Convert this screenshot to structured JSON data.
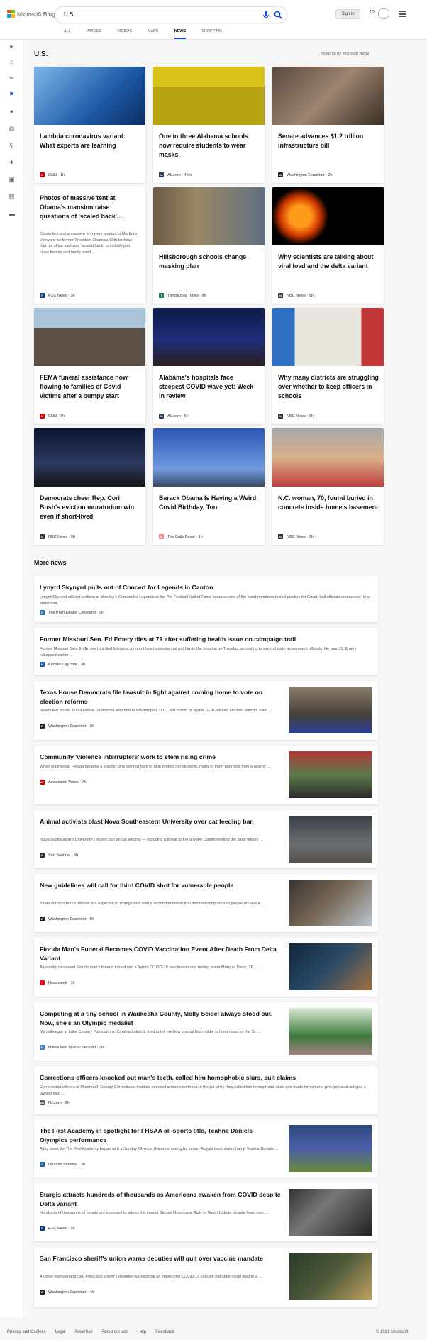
{
  "header": {
    "logo_text": "Microsoft Bing",
    "search_value": "U.S.",
    "signin": "Sign in",
    "rewards_count": "10",
    "tabs": [
      "ALL",
      "IMAGES",
      "VIDEOS",
      "MAPS",
      "NEWS",
      "SHOPPING"
    ],
    "active_tab": "NEWS",
    "logo_colors": [
      "#f25022",
      "#7fba00",
      "#00a4ef",
      "#ffb900"
    ],
    "accent": "#174ae4"
  },
  "rail": {
    "icons": [
      "expand-icon",
      "home-icon",
      "sparkle-icon",
      "flag-icon",
      "pin-icon",
      "globe-icon",
      "microscope-icon",
      "rocket-icon",
      "film-icon",
      "bank-icon",
      "card-icon"
    ]
  },
  "page": {
    "title": "U.S.",
    "powered_by": "Powered by Microsoft News"
  },
  "cards": [
    {
      "title": "Lambda coronavirus variant: What experts are learning",
      "source": "CNN",
      "time": "1h"
    },
    {
      "title": "One in three Alabama schools now require students to wear masks",
      "source": "AL.com",
      "time": "45m"
    },
    {
      "title": "Senate advances $1.2 trillion infrastructure bill",
      "source": "Washington Examiner",
      "time": "2h"
    },
    {
      "title": "Photos of massive tent at Obama's mansion raise questions of 'scaled back'...",
      "snippet": "Celebrities and a massive tent were spotted in Martha's Vineyard for former President Obama's 60th birthday that his office said was \"scaled back\" to include just close friends and family amid ...",
      "source": "FOX News",
      "time": "3h"
    },
    {
      "title": "Hillsborough schools change masking plan",
      "source": "Tampa Bay Times",
      "time": "9h"
    },
    {
      "title": "Why scientists are talking about viral load and the delta variant",
      "source": "NBC News",
      "time": "5h"
    },
    {
      "title": "FEMA funeral assistance now flowing to families of Covid victims after a bumpy start",
      "source": "CNN",
      "time": "7h"
    },
    {
      "title": "Alabama's hospitals face steepest COVID wave yet: Week in review",
      "source": "AL.com",
      "time": "6h"
    },
    {
      "title": "Why many districts are struggling over whether to keep officers in schools",
      "source": "NBC News",
      "time": "9h"
    },
    {
      "title": "Democrats cheer Rep. Cori Bush's eviction moratorium win, even if short-lived",
      "source": "NBC News",
      "time": "9h"
    },
    {
      "title": "Barack Obama Is Having a Weird Covid Birthday, Too",
      "source": "The Daily Beast",
      "time": "1h"
    },
    {
      "title": "N.C. woman, 70, found buried in concrete inside home's basement",
      "source": "NBC News",
      "time": "3h"
    }
  ],
  "more_news": {
    "title": "More news",
    "items": [
      {
        "headline": "Lynyrd Skynyrd pulls out of Concert for Legends in Canton",
        "snippet": "Lynyrd Skynyrd will not perform at Monday's Concert for Legends at the Pro Football Hall of Fame because one of the band members tested positive for Covid, hall officials announced. In a statement, ...",
        "source": "The Plain Dealer Cleveland",
        "time": "2h"
      },
      {
        "headline": "Former Missouri Sen. Ed Emery dies at 71 after suffering health issue on campaign trail",
        "snippet": "Former Missouri Sen. Ed Emery has died following a recent heart episode that put him in the hospital on Tuesday, according to several state government officials. He was 71. Emery collapsed earlier ...",
        "source": "Kansas City Star",
        "time": "3h"
      },
      {
        "headline": "Texas House Democrats file lawsuit in fight against coming home to vote on election reforms",
        "snippet": "Nearly two dozen Texas House Democrats who fled to Washington, D.C., last month to stymie GOP-backed election reforms sued ...",
        "source": "Washington Examiner",
        "time": "3h"
      },
      {
        "headline": "Community 'violence interrupters' work to stem rising crime",
        "snippet": "When Rasheedat Fetuga became a teacher, she worked hard to help protect her students, many of them poor and from a nearby ...",
        "source": "Associated Press",
        "time": "7h"
      },
      {
        "headline": "Animal activists blast Nova Southeastern University over cat feeding ban",
        "snippet": "Nova Southeastern University's recent ban on cat feeding — including a threat to fire anyone caught feeding the stray felines ...",
        "source": "Sun Sentinel",
        "time": "6h"
      },
      {
        "headline": "New guidelines will call for third COVID shot for vulnerable people",
        "snippet": "Biden administration officials are expected to change tack with a recommendation that immunocompromised people receive a ...",
        "source": "Washington Examiner",
        "time": "9h"
      },
      {
        "headline": "Florida Man's Funeral Becomes COVID Vaccination Event After Death From Delta Variant",
        "snippet": "A recently deceased Florida man's funeral turned into a hybrid COVID-19 vaccination and testing event Marquis Davis, 28, ...",
        "source": "Newsweek",
        "time": "1h"
      },
      {
        "headline": "Competing at a tiny school in Waukesha County, Molly Seidel always stood out. Now, she's an Olympic medalist",
        "snippet": "My colleague at Lake Country Publications, Cynthia Luksich, tried to tell me how special this middle schooler was on the St. ...",
        "source": "Milwaukee Journal Sentinel",
        "time": "2h"
      },
      {
        "headline": "Corrections officers knocked out man's teeth, called him homophobic slurs, suit claims",
        "snippet": "Correctional officers at Monmouth County Correctional Institute knocked a man's teeth out in the jail while they called him homophobic slurs and made him wear a pink jumpsuit, alleges a lawsuit filed ...",
        "source": "NJ.com",
        "time": "2h"
      },
      {
        "headline": "The First Academy in spotlight for FHSAA all-sports title, Teahna Daniels Olympics performance",
        "snippet": "A big week for The First Academy began with a Sunday Olympic Games showing by former Royals track state champ Teahna Daniels ...",
        "source": "Orlando Sentinel",
        "time": "3h"
      },
      {
        "headline": "Sturgis attracts hundreds of thousands as Americans awaken from COVID despite Delta variant",
        "snippet": "Hundreds of thousands of people are expected to attend the annual Sturgis Motorcycle Rally in South Dakota despite fears over ...",
        "source": "FOX News",
        "time": "5h"
      },
      {
        "headline": "San Francisco sheriff's union warns deputies will quit over vaccine mandate",
        "snippet": "A union representing San Francisco sheriff's deputies warned that an impending COVID-19 vaccine mandate could lead to a ...",
        "source": "Washington Examiner",
        "time": "4h"
      }
    ]
  },
  "footer": {
    "links": [
      "Privacy and Cookies",
      "Legal",
      "Advertise",
      "About our ads",
      "Help",
      "Feedback"
    ],
    "copyright": "© 2021 Microsoft"
  }
}
